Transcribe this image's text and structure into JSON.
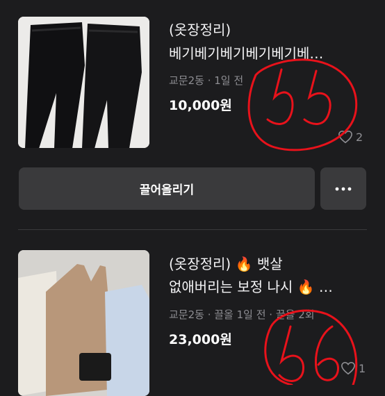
{
  "items": [
    {
      "title_line1": "(옷장정리)",
      "title_line2": "베기베기베기베기베기베…",
      "meta": "교문2동 · 1일 전",
      "price": "10,000원",
      "likes": "2"
    },
    {
      "title_line1": "(옷장정리) 🔥 뱃살",
      "title_line2": "없애버리는 보정 나시 🔥 …",
      "meta": "교문2동 · 끌올 1일 전 · 끌올 2회",
      "price": "23,000원",
      "likes": "1"
    }
  ],
  "actions": {
    "bump_label": "끌어올리기"
  },
  "annotations": {
    "first": "55",
    "second": "56"
  },
  "colors": {
    "background": "#1c1c1e",
    "button": "#3a3a3c",
    "muted": "#8e8e93",
    "annotation": "#e8121b"
  }
}
